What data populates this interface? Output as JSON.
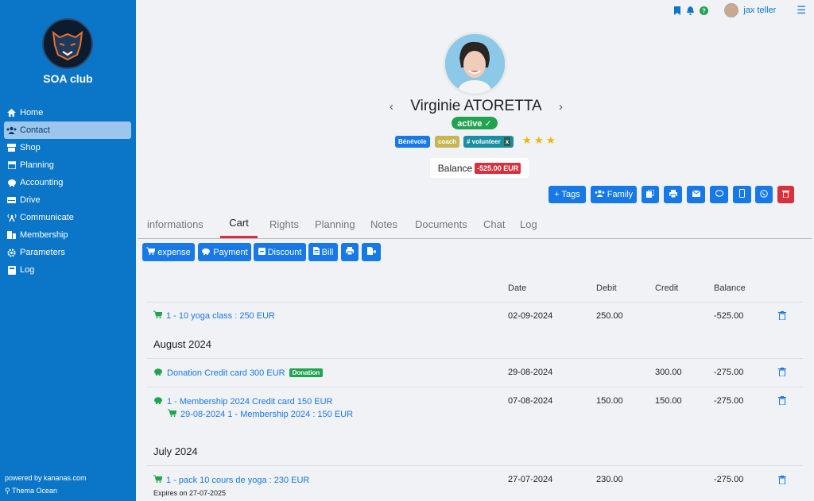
{
  "sidebar": {
    "club_name": "SOA club",
    "items": [
      {
        "label": "Home",
        "icon": "home-icon"
      },
      {
        "label": "Contact",
        "icon": "users-icon",
        "active": true
      },
      {
        "label": "Shop",
        "icon": "shop-icon"
      },
      {
        "label": "Planning",
        "icon": "calendar-icon"
      },
      {
        "label": "Accounting",
        "icon": "piggy-bank-icon"
      },
      {
        "label": "Drive",
        "icon": "drive-icon"
      },
      {
        "label": "Communicate",
        "icon": "broadcast-icon"
      },
      {
        "label": "Membership",
        "icon": "membership-icon"
      },
      {
        "label": "Parameters",
        "icon": "gear-icon"
      },
      {
        "label": "Log",
        "icon": "book-icon"
      }
    ],
    "powered_by": "powered by kananas.com",
    "theme": "Thema Ocean"
  },
  "topbar": {
    "user_name": "jax teller"
  },
  "profile": {
    "name": "Virginie ATORETTA",
    "status": "active ✓",
    "tags": [
      "Bénévole",
      "coach",
      "# volunteer"
    ],
    "tag_remove": "x",
    "stars": 3,
    "balance_label": "Balance",
    "balance_value": "-525.00 EUR"
  },
  "actions": {
    "tags_label": "+ Tags",
    "family_label": "Family"
  },
  "tabs": [
    "informations",
    "Cart",
    "Rights",
    "Planning",
    "Notes",
    "Documents",
    "Chat",
    "Log"
  ],
  "active_tab": "Cart",
  "cart_buttons": {
    "expense": "expense",
    "payment": "Payment",
    "discount": "Discount",
    "bill": "Bill"
  },
  "table": {
    "headers": {
      "date": "Date",
      "debit": "Debit",
      "credit": "Credit",
      "balance": "Balance"
    },
    "rows": [
      {
        "label": "1 - 10 yoga class : 250 EUR",
        "date": "02-09-2024",
        "debit": "250.00",
        "credit": "",
        "balance": "-525.00"
      },
      {
        "label": "Donation Credit card 300 EUR",
        "badge": "Donation",
        "date": "29-08-2024",
        "debit": "",
        "credit": "300.00",
        "balance": "-275.00"
      },
      {
        "label": "1 - Membership 2024 Credit card 150 EUR",
        "sublabel": "29-08-2024 1 - Membership 2024 : 150 EUR",
        "date": "07-08-2024",
        "debit": "150.00",
        "credit": "150.00",
        "balance": "-275.00"
      },
      {
        "label": "1 - pack 10 cours de yoga : 230 EUR",
        "note": "Expires on 27-07-2025",
        "date": "27-07-2024",
        "debit": "230.00",
        "credit": "",
        "balance": "-275.00"
      }
    ],
    "months": [
      "August 2024",
      "July 2024"
    ]
  },
  "colors": {
    "sidebar": "#0b76c7",
    "primary": "#1778e8",
    "danger": "#d9303e",
    "success": "#20a44f"
  }
}
